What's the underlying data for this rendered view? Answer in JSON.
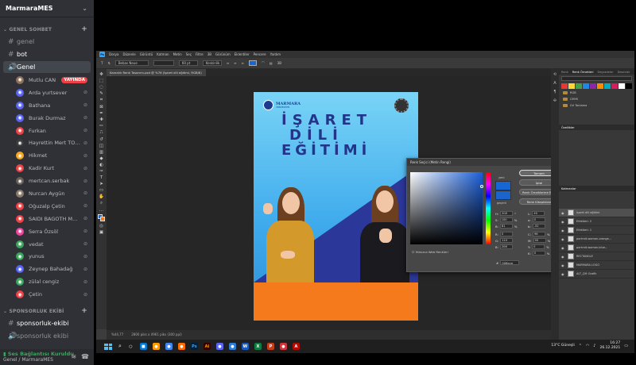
{
  "discord": {
    "server_name": "MarmaraMES",
    "category_general": "GENEL SOHBET",
    "channels": [
      {
        "name": "genel",
        "glyph": "#",
        "style": "muted"
      },
      {
        "name": "bot",
        "glyph": "#",
        "style": "bright"
      },
      {
        "name": "Genel",
        "glyph": "🔊",
        "style": "active"
      }
    ],
    "voice_members": [
      {
        "name": "Mutlu CAN",
        "badge": "YAYINDA",
        "color": "#8e6f5a"
      },
      {
        "name": "Arda yurtsever",
        "color": "#5865f2"
      },
      {
        "name": "Bathana",
        "color": "#5865f2"
      },
      {
        "name": "Burak Durmaz",
        "color": "#5865f2"
      },
      {
        "name": "Furkan",
        "color": "#ed4245"
      },
      {
        "name": "Hayrettin Mert TOP...",
        "color": "#3b3b3b"
      },
      {
        "name": "Hikmet",
        "color": "#faa61a"
      },
      {
        "name": "Kadir Kurt",
        "color": "#ed4245"
      },
      {
        "name": "mertcan.serbak",
        "color": "#6a5f55"
      },
      {
        "name": "Nurcan Aygün",
        "color": "#8a7a6a"
      },
      {
        "name": "Oğuzalp Çetin",
        "color": "#ed4245"
      },
      {
        "name": "SAIDI BAGOTH M...",
        "color": "#ed4245"
      },
      {
        "name": "Serra Özsöl",
        "color": "#eb459e"
      },
      {
        "name": "vedat",
        "color": "#3ba55d"
      },
      {
        "name": "yunus",
        "color": "#3ba55d"
      },
      {
        "name": "Zeynep Bahadağ",
        "color": "#5865f2"
      },
      {
        "name": "zülal cengiz",
        "color": "#3ba55d"
      },
      {
        "name": "Çetin",
        "color": "#ed4245"
      }
    ],
    "category_sponsor": "SPONSORLUK EKİBİ",
    "sponsor_channels": [
      {
        "name": "sponsorluk-ekibi",
        "glyph": "#",
        "style": "bright"
      },
      {
        "name": "sponsorluk ekibi",
        "glyph": "🔊",
        "style": "muted"
      }
    ],
    "voice_status": "Ses Bağlantısı Kuruldu",
    "voice_sub": "Genel / MarmaraMES"
  },
  "photoshop": {
    "menu": [
      "Dosya",
      "Düzenle",
      "Görüntü",
      "Katman",
      "Metin",
      "Seç",
      "Filtre",
      "3B",
      "Görünüm",
      "Eklentiler",
      "Pencere",
      "Yardım"
    ],
    "doc_tab": "Karanlık Renk Tasarımı.psd @ %76 (İşaret dili eğitimi, RGB/8) *",
    "font_family": "Bebas Neue",
    "font_size": "60 pt",
    "antialias": "Keskinlik",
    "status_zoom": "%44,77",
    "status_doc": "2800 piks x 4961 piks (300 ppi)",
    "poster": {
      "logo_text": "MARMARA",
      "logo_sub": "ÜNİVERSİTESİ",
      "title_lines": [
        "İŞARET",
        "DİLİ",
        "EĞİTİMİ"
      ]
    },
    "picker": {
      "title": "Renk Seçici (Metin Rengi)",
      "label_new": "yeni",
      "label_current": "geçerli",
      "ok": "Tamam",
      "cancel": "İptal",
      "add_swatch": "Renk Örneklerine Ekle",
      "libraries": "Renk Kitaplıkları",
      "websafe": "Yalnızca Web Renkleri",
      "fields": [
        {
          "label": "H:",
          "value": "200",
          "unit": "°"
        },
        {
          "label": "S:",
          "value": "100",
          "unit": "%"
        },
        {
          "label": "B:",
          "value": "81",
          "unit": "%"
        },
        {
          "label": "R:",
          "value": "0",
          "unit": ""
        },
        {
          "label": "G:",
          "value": "110",
          "unit": ""
        },
        {
          "label": "B:",
          "value": "206",
          "unit": ""
        },
        {
          "label": "L:",
          "value": "45",
          "unit": ""
        },
        {
          "label": "a:",
          "value": "0",
          "unit": ""
        },
        {
          "label": "b:",
          "value": "-52",
          "unit": ""
        },
        {
          "label": "C:",
          "value": "96",
          "unit": "%"
        },
        {
          "label": "M:",
          "value": "50",
          "unit": "%"
        },
        {
          "label": "Y:",
          "value": "0",
          "unit": "%"
        },
        {
          "label": "K:",
          "value": "0",
          "unit": "%"
        }
      ],
      "hex": "006ece"
    },
    "right_panel": {
      "swatch_tabs": [
        "Renk",
        "Renk Örnekleri",
        "Degradeler",
        "Desenler"
      ],
      "swatch_colors": [
        "#e53935",
        "#fdd835",
        "#43a047",
        "#1e88e5",
        "#8e24aa",
        "#fb8c00",
        "#00acc1",
        "#d81b60",
        "#ffffff",
        "#000000"
      ],
      "swatch_folders": [
        "RGB",
        "CMYK",
        "Gri Tonlama"
      ],
      "properties_tab": "Özellikler",
      "layers_tab": "Katmanlar",
      "layers": [
        {
          "name": "İşaret dili eğitimi",
          "selected": true
        },
        {
          "name": "Efektleri: 2",
          "selected": false
        },
        {
          "name": "Efektleri: 1",
          "selected": false
        },
        {
          "name": "portrait-woman-orange...",
          "selected": false
        },
        {
          "name": "portrait-woman-blue...",
          "selected": false
        },
        {
          "name": "RECTANGLE",
          "selected": false
        },
        {
          "name": "MARMARA LOGO",
          "selected": false
        },
        {
          "name": "ALT_Çift Grafik",
          "selected": false
        }
      ]
    }
  },
  "taskbar": {
    "weather": "13°C  Güneşli",
    "time": "16:27",
    "date": "26.12.2021",
    "apps": [
      {
        "label": "○",
        "bg": "#1f1f1f",
        "fg": "#fff"
      },
      {
        "label": "■",
        "bg": "#0078d4",
        "fg": "#fff"
      },
      {
        "label": "●",
        "bg": "#ff9900",
        "fg": "#fff"
      },
      {
        "label": "●",
        "bg": "#4285f4",
        "fg": "#fff"
      },
      {
        "label": "●",
        "bg": "#ff6b00",
        "fg": "#fff"
      },
      {
        "label": "Ps",
        "bg": "#001e36",
        "fg": "#31a8ff"
      },
      {
        "label": "Ai",
        "bg": "#330000",
        "fg": "#ff9a00"
      },
      {
        "label": "●",
        "bg": "#5865f2",
        "fg": "#fff"
      },
      {
        "label": "●",
        "bg": "#2b7bd9",
        "fg": "#fff"
      },
      {
        "label": "W",
        "bg": "#185abd",
        "fg": "#fff"
      },
      {
        "label": "X",
        "bg": "#107c41",
        "fg": "#fff"
      },
      {
        "label": "P",
        "bg": "#c43e1c",
        "fg": "#fff"
      },
      {
        "label": "●",
        "bg": "#d13438",
        "fg": "#fff"
      },
      {
        "label": "A",
        "bg": "#b30b00",
        "fg": "#fff"
      }
    ]
  }
}
